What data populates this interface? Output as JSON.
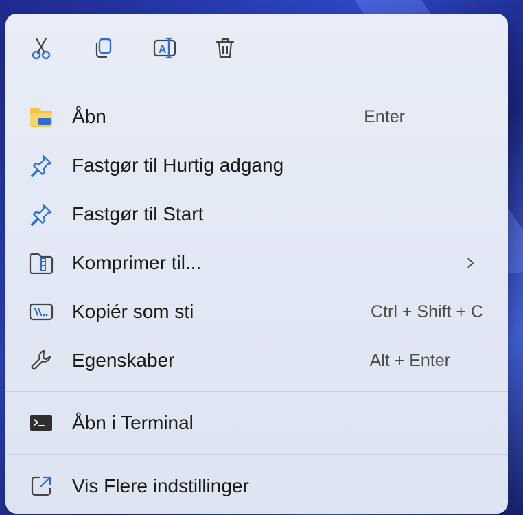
{
  "toolbar": {
    "buttons": [
      {
        "icon": "cut-icon"
      },
      {
        "icon": "copy-icon"
      },
      {
        "icon": "rename-icon"
      },
      {
        "icon": "delete-icon"
      }
    ]
  },
  "menu": {
    "items": [
      {
        "label": "Åbn",
        "shortcut": "Enter",
        "icon": "folder-icon"
      },
      {
        "label": "Fastgør til Hurtig adgang",
        "shortcut": "",
        "icon": "pin-icon"
      },
      {
        "label": "Fastgør til Start",
        "shortcut": "",
        "icon": "pin-icon"
      },
      {
        "label": "Komprimer til...",
        "shortcut": "",
        "icon": "zip-folder-icon",
        "submenu": true
      },
      {
        "label": "Kopiér som sti",
        "shortcut": "Ctrl + Shift + C",
        "icon": "copy-path-icon"
      },
      {
        "label": "Egenskaber",
        "shortcut": "Alt + Enter",
        "icon": "wrench-icon"
      },
      {
        "label": "Åbn i Terminal",
        "shortcut": "",
        "icon": "terminal-icon"
      },
      {
        "label": "Vis Flere indstillinger",
        "shortcut": "",
        "icon": "more-options-icon"
      }
    ]
  },
  "colors": {
    "accent": "#2b6fd6",
    "folder_yellow": "#f6c342",
    "menu_bg": "#e4e9f4"
  }
}
